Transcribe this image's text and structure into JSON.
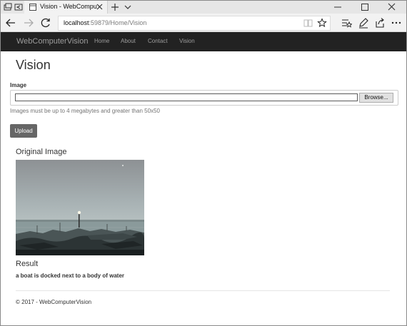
{
  "browser": {
    "tab_title": "Vision - WebComputerV",
    "url_host": "localhost",
    "url_path": ":59879/Home/Vision"
  },
  "navbar": {
    "brand": "WebComputerVision",
    "links": [
      "Home",
      "About",
      "Contact",
      "Vision"
    ]
  },
  "page": {
    "heading": "Vision",
    "image_label": "Image",
    "browse_label": "Browse...",
    "help_text": "Images must be up to 4 megabytes and greater than 50x50",
    "upload_label": "Upload",
    "original_heading": "Original Image",
    "result_heading": "Result",
    "result_caption": "a boat is docked next to a body of water"
  },
  "footer": {
    "text": "© 2017 - WebComputerVision"
  },
  "icons": {
    "titlebar_left": [
      "tab-manager-icon",
      "tab-back-icon"
    ],
    "favicon": "page-icon",
    "nav": [
      "back-arrow-icon",
      "forward-arrow-icon",
      "refresh-icon"
    ],
    "address": [
      "reading-view-icon",
      "favorite-star-icon"
    ],
    "toolbar": [
      "hub-icon",
      "web-note-icon",
      "share-icon",
      "more-icon"
    ]
  },
  "colors": {
    "navbar_bg": "#222222",
    "navbar_text": "#9d9d9d",
    "upload_bg": "#666666",
    "chrome_bg": "#f2f2f2"
  }
}
